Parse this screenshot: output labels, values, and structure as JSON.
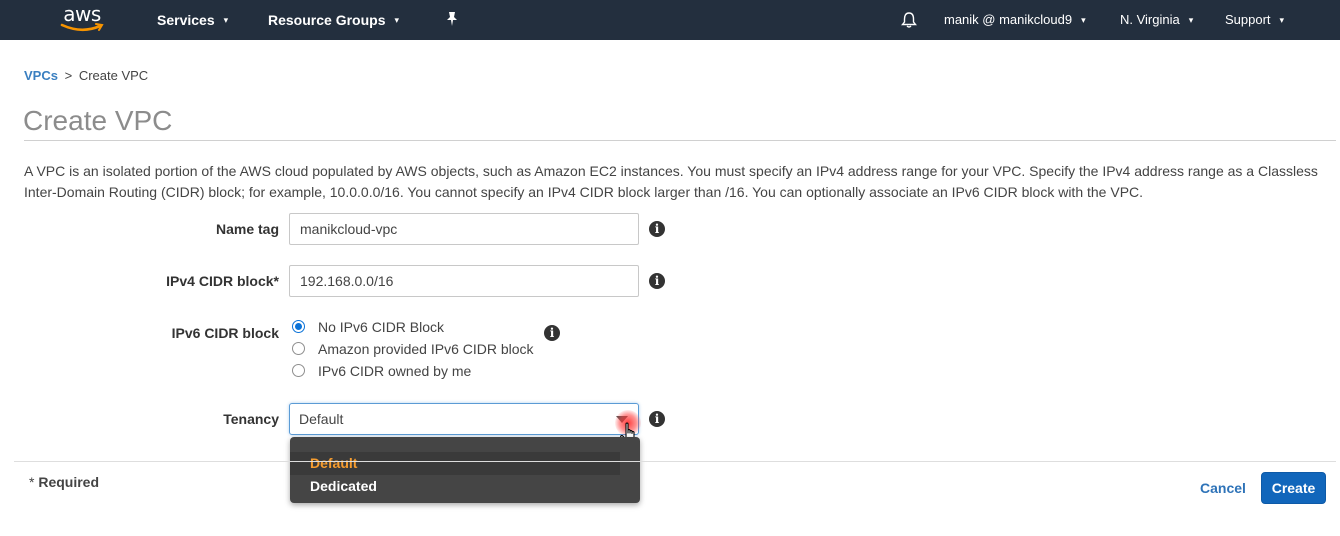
{
  "topnav": {
    "logo_text": "aws",
    "services_label": "Services",
    "resource_groups_label": "Resource Groups",
    "user_label": "manik @ manikcloud9",
    "region_label": "N. Virginia",
    "support_label": "Support",
    "caret": "▾",
    "pin_icon": "pushpin-icon",
    "bell_icon": "bell-icon"
  },
  "breadcrumb": {
    "parent": "VPCs",
    "separator": ">",
    "current": "Create VPC"
  },
  "page": {
    "title": "Create VPC",
    "description": "A VPC is an isolated portion of the AWS cloud populated by AWS objects, such as Amazon EC2 instances. You must specify an IPv4 address range for your VPC. Specify the IPv4 address range as a Classless Inter-Domain Routing (CIDR) block; for example, 10.0.0.0/16. You cannot specify an IPv4 CIDR block larger than /16. You can optionally associate an IPv6 CIDR block with the VPC."
  },
  "form": {
    "name_tag": {
      "label": "Name tag",
      "value": "manikcloud-vpc"
    },
    "ipv4_cidr": {
      "label": "IPv4 CIDR block*",
      "value": "192.168.0.0/16"
    },
    "ipv6_cidr": {
      "label": "IPv6 CIDR block",
      "options": [
        {
          "label": "No IPv6 CIDR Block",
          "checked": true
        },
        {
          "label": "Amazon provided IPv6 CIDR block",
          "checked": false
        },
        {
          "label": "IPv6 CIDR owned by me",
          "checked": false
        }
      ]
    },
    "tenancy": {
      "label": "Tenancy",
      "value": "Default",
      "options": [
        "Default",
        "Dedicated"
      ],
      "highlighted": "Default"
    },
    "info_glyph": "i"
  },
  "footer": {
    "required_asterisk": "*",
    "required_label": "Required",
    "cancel_label": "Cancel",
    "create_label": "Create"
  },
  "colors": {
    "nav_bg": "#232f3e",
    "link_blue": "#3a7fc0",
    "primary_button": "#1166bb",
    "dropdown_bg": "#454545",
    "dropdown_selected_text": "#f79d2f",
    "logo_smile": "#f79400"
  }
}
